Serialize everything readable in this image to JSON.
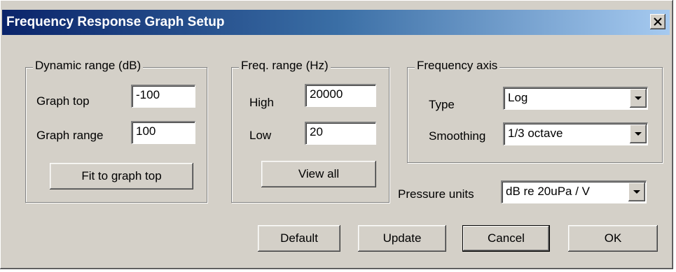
{
  "window": {
    "title": "Frequency Response Graph Setup",
    "close_glyph": "✕"
  },
  "dynamic_range": {
    "legend": "Dynamic range (dB)",
    "graph_top_label": "Graph top",
    "graph_top_value": "-100",
    "graph_range_label": "Graph range",
    "graph_range_value": "100",
    "fit_button": "Fit to graph top"
  },
  "freq_range": {
    "legend": "Freq. range (Hz)",
    "high_label": "High",
    "high_value": "20000",
    "low_label": "Low",
    "low_value": "20",
    "view_all_button": "View all"
  },
  "frequency_axis": {
    "legend": "Frequency axis",
    "type_label": "Type",
    "type_value": "Log",
    "smoothing_label": "Smoothing",
    "smoothing_value": "1/3 octave"
  },
  "pressure": {
    "label": "Pressure units",
    "value": "dB re 20uPa / V"
  },
  "buttons": {
    "default": "Default",
    "update": "Update",
    "cancel": "Cancel",
    "ok": "OK"
  },
  "icons": {
    "close": "close-icon",
    "dropdown": "chevron-down-icon"
  }
}
